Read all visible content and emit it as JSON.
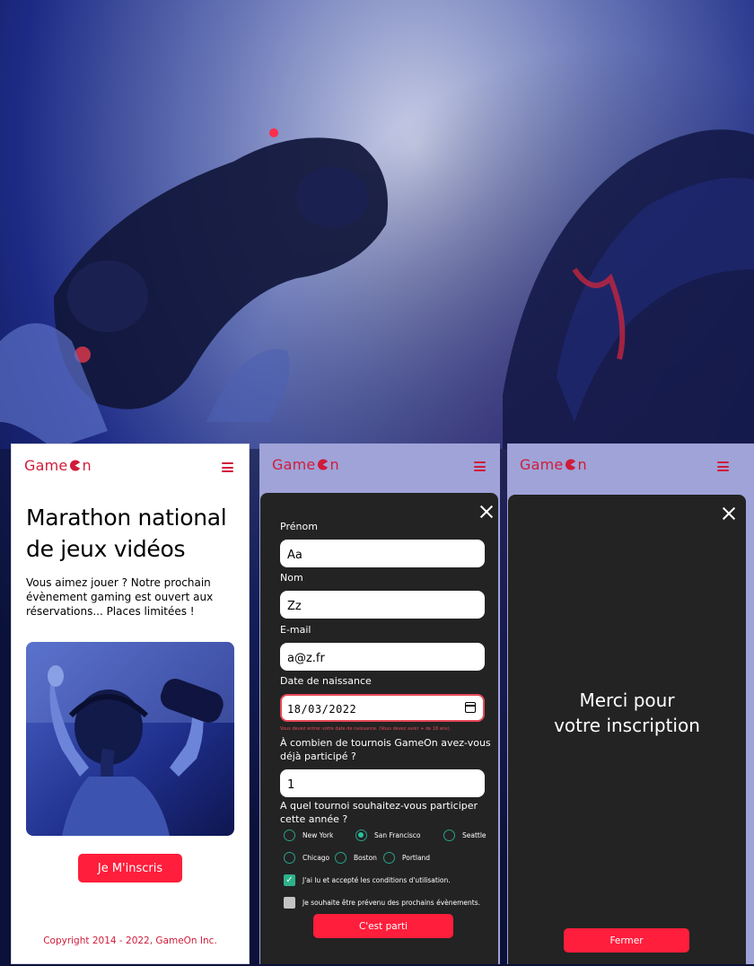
{
  "brand": {
    "logo_left": "Game",
    "logo_right": "n",
    "accent": "#ff1e3b",
    "logo_color": "#d01c3a"
  },
  "home": {
    "title": "Marathon national de jeux vidéos",
    "intro": "Vous aimez jouer ? Notre prochain évènement gaming est ouvert aux réservations... Places limitées !",
    "cta_label": "Je M'inscris",
    "copyright": "Copyright 2014 - 2022, GameOn Inc."
  },
  "form": {
    "first_name_label": "Prénom",
    "first_name_value": "Aa",
    "last_name_label": "Nom",
    "last_name_value": "Zz",
    "email_label": "E-mail",
    "email_value": "a@z.fr",
    "birthdate_label": "Date de naissance",
    "birthdate_value": "18/03/2022",
    "birthdate_error": "Vous devez entrer votre date de naissance. (Vous devez avoir + de 18 ans).",
    "tournaments_question": "À combien de tournois GameOn avez-vous déjà participé ?",
    "tournaments_value": "1",
    "location_question": "A quel tournoi souhaitez-vous participer cette année ?",
    "locations": [
      "New York",
      "San Francisco",
      "Seattle",
      "Chicago",
      "Boston",
      "Portland"
    ],
    "selected_location": "San Francisco",
    "terms_label": "J'ai lu et accepté les conditions d'utilisation.",
    "newsletter_label": "Je souhaite être prévenu des prochains évènements.",
    "submit_label": "C'est parti"
  },
  "confirmation": {
    "line1": "Merci pour",
    "line2": "votre inscription",
    "close_label": "Fermer"
  }
}
